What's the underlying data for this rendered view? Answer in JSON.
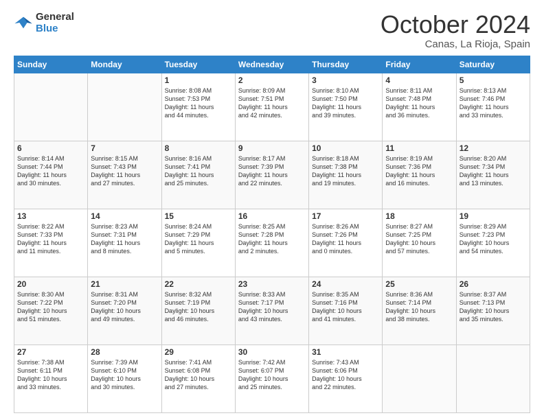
{
  "header": {
    "logo_line1": "General",
    "logo_line2": "Blue",
    "month": "October 2024",
    "location": "Canas, La Rioja, Spain"
  },
  "days_of_week": [
    "Sunday",
    "Monday",
    "Tuesday",
    "Wednesday",
    "Thursday",
    "Friday",
    "Saturday"
  ],
  "weeks": [
    [
      {
        "day": "",
        "lines": []
      },
      {
        "day": "",
        "lines": []
      },
      {
        "day": "1",
        "lines": [
          "Sunrise: 8:08 AM",
          "Sunset: 7:53 PM",
          "Daylight: 11 hours",
          "and 44 minutes."
        ]
      },
      {
        "day": "2",
        "lines": [
          "Sunrise: 8:09 AM",
          "Sunset: 7:51 PM",
          "Daylight: 11 hours",
          "and 42 minutes."
        ]
      },
      {
        "day": "3",
        "lines": [
          "Sunrise: 8:10 AM",
          "Sunset: 7:50 PM",
          "Daylight: 11 hours",
          "and 39 minutes."
        ]
      },
      {
        "day": "4",
        "lines": [
          "Sunrise: 8:11 AM",
          "Sunset: 7:48 PM",
          "Daylight: 11 hours",
          "and 36 minutes."
        ]
      },
      {
        "day": "5",
        "lines": [
          "Sunrise: 8:13 AM",
          "Sunset: 7:46 PM",
          "Daylight: 11 hours",
          "and 33 minutes."
        ]
      }
    ],
    [
      {
        "day": "6",
        "lines": [
          "Sunrise: 8:14 AM",
          "Sunset: 7:44 PM",
          "Daylight: 11 hours",
          "and 30 minutes."
        ]
      },
      {
        "day": "7",
        "lines": [
          "Sunrise: 8:15 AM",
          "Sunset: 7:43 PM",
          "Daylight: 11 hours",
          "and 27 minutes."
        ]
      },
      {
        "day": "8",
        "lines": [
          "Sunrise: 8:16 AM",
          "Sunset: 7:41 PM",
          "Daylight: 11 hours",
          "and 25 minutes."
        ]
      },
      {
        "day": "9",
        "lines": [
          "Sunrise: 8:17 AM",
          "Sunset: 7:39 PM",
          "Daylight: 11 hours",
          "and 22 minutes."
        ]
      },
      {
        "day": "10",
        "lines": [
          "Sunrise: 8:18 AM",
          "Sunset: 7:38 PM",
          "Daylight: 11 hours",
          "and 19 minutes."
        ]
      },
      {
        "day": "11",
        "lines": [
          "Sunrise: 8:19 AM",
          "Sunset: 7:36 PM",
          "Daylight: 11 hours",
          "and 16 minutes."
        ]
      },
      {
        "day": "12",
        "lines": [
          "Sunrise: 8:20 AM",
          "Sunset: 7:34 PM",
          "Daylight: 11 hours",
          "and 13 minutes."
        ]
      }
    ],
    [
      {
        "day": "13",
        "lines": [
          "Sunrise: 8:22 AM",
          "Sunset: 7:33 PM",
          "Daylight: 11 hours",
          "and 11 minutes."
        ]
      },
      {
        "day": "14",
        "lines": [
          "Sunrise: 8:23 AM",
          "Sunset: 7:31 PM",
          "Daylight: 11 hours",
          "and 8 minutes."
        ]
      },
      {
        "day": "15",
        "lines": [
          "Sunrise: 8:24 AM",
          "Sunset: 7:29 PM",
          "Daylight: 11 hours",
          "and 5 minutes."
        ]
      },
      {
        "day": "16",
        "lines": [
          "Sunrise: 8:25 AM",
          "Sunset: 7:28 PM",
          "Daylight: 11 hours",
          "and 2 minutes."
        ]
      },
      {
        "day": "17",
        "lines": [
          "Sunrise: 8:26 AM",
          "Sunset: 7:26 PM",
          "Daylight: 11 hours",
          "and 0 minutes."
        ]
      },
      {
        "day": "18",
        "lines": [
          "Sunrise: 8:27 AM",
          "Sunset: 7:25 PM",
          "Daylight: 10 hours",
          "and 57 minutes."
        ]
      },
      {
        "day": "19",
        "lines": [
          "Sunrise: 8:29 AM",
          "Sunset: 7:23 PM",
          "Daylight: 10 hours",
          "and 54 minutes."
        ]
      }
    ],
    [
      {
        "day": "20",
        "lines": [
          "Sunrise: 8:30 AM",
          "Sunset: 7:22 PM",
          "Daylight: 10 hours",
          "and 51 minutes."
        ]
      },
      {
        "day": "21",
        "lines": [
          "Sunrise: 8:31 AM",
          "Sunset: 7:20 PM",
          "Daylight: 10 hours",
          "and 49 minutes."
        ]
      },
      {
        "day": "22",
        "lines": [
          "Sunrise: 8:32 AM",
          "Sunset: 7:19 PM",
          "Daylight: 10 hours",
          "and 46 minutes."
        ]
      },
      {
        "day": "23",
        "lines": [
          "Sunrise: 8:33 AM",
          "Sunset: 7:17 PM",
          "Daylight: 10 hours",
          "and 43 minutes."
        ]
      },
      {
        "day": "24",
        "lines": [
          "Sunrise: 8:35 AM",
          "Sunset: 7:16 PM",
          "Daylight: 10 hours",
          "and 41 minutes."
        ]
      },
      {
        "day": "25",
        "lines": [
          "Sunrise: 8:36 AM",
          "Sunset: 7:14 PM",
          "Daylight: 10 hours",
          "and 38 minutes."
        ]
      },
      {
        "day": "26",
        "lines": [
          "Sunrise: 8:37 AM",
          "Sunset: 7:13 PM",
          "Daylight: 10 hours",
          "and 35 minutes."
        ]
      }
    ],
    [
      {
        "day": "27",
        "lines": [
          "Sunrise: 7:38 AM",
          "Sunset: 6:11 PM",
          "Daylight: 10 hours",
          "and 33 minutes."
        ]
      },
      {
        "day": "28",
        "lines": [
          "Sunrise: 7:39 AM",
          "Sunset: 6:10 PM",
          "Daylight: 10 hours",
          "and 30 minutes."
        ]
      },
      {
        "day": "29",
        "lines": [
          "Sunrise: 7:41 AM",
          "Sunset: 6:08 PM",
          "Daylight: 10 hours",
          "and 27 minutes."
        ]
      },
      {
        "day": "30",
        "lines": [
          "Sunrise: 7:42 AM",
          "Sunset: 6:07 PM",
          "Daylight: 10 hours",
          "and 25 minutes."
        ]
      },
      {
        "day": "31",
        "lines": [
          "Sunrise: 7:43 AM",
          "Sunset: 6:06 PM",
          "Daylight: 10 hours",
          "and 22 minutes."
        ]
      },
      {
        "day": "",
        "lines": []
      },
      {
        "day": "",
        "lines": []
      }
    ]
  ]
}
